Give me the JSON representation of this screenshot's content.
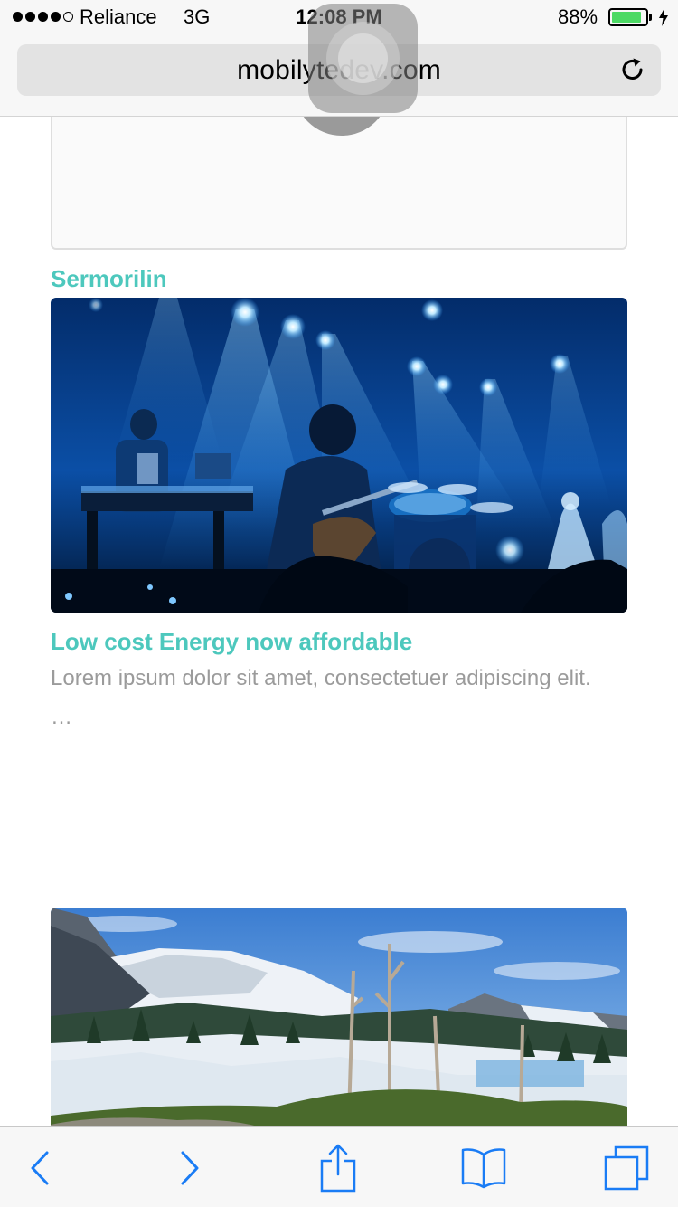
{
  "status_bar": {
    "carrier": "Reliance",
    "network": "3G",
    "time": "12:08 PM",
    "battery_percent": "88%",
    "battery_level": 0.88,
    "signal_bars": 4,
    "signal_total": 5
  },
  "browser": {
    "url": "mobilytedev.com",
    "reload_icon": "reload-icon"
  },
  "content": {
    "section_title": "Sermorilin",
    "article": {
      "title": "Low cost Energy now affordable",
      "excerpt": "Lorem ipsum dolor sit amet, consectetuer adipiscing elit.",
      "ellipsis": "…"
    },
    "images": [
      "concert-photo",
      "snowy-mountain-photo"
    ]
  },
  "toolbar": {
    "icons": [
      "back-icon",
      "forward-icon",
      "share-icon",
      "bookmarks-icon",
      "tabs-icon"
    ]
  },
  "colors": {
    "accent": "#4dc8bd",
    "ios_blue": "#1a7cf5",
    "battery_green": "#4cd964",
    "excerpt_gray": "#9b9b9b"
  }
}
